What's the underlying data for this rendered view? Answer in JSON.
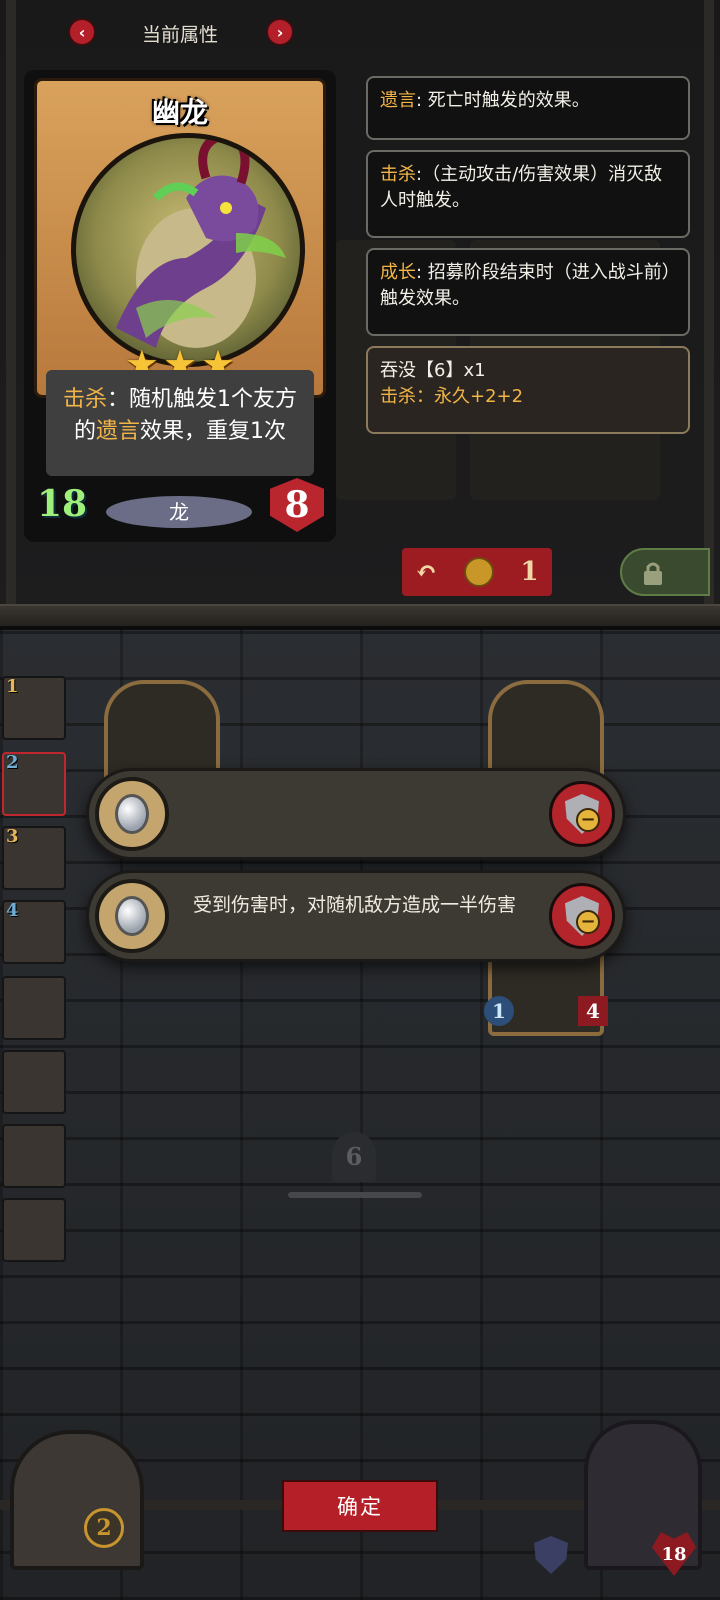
{
  "header": {
    "title": "当前属性",
    "prev_icon": "chevron-left-icon",
    "next_icon": "chevron-right-icon",
    "prev_glyph": "‹",
    "next_glyph": "›"
  },
  "card": {
    "name": "幽龙",
    "stars": 3,
    "star_glyph": "★",
    "ability_keyword": "击杀",
    "ability_part1": "：随机触发1个友方的",
    "ability_keyword2": "遗言",
    "ability_part2": "效果，重复1次",
    "attack": "18",
    "tribe": "龙",
    "health": "8"
  },
  "tooltips": [
    {
      "keyword": "遗言",
      "text": ": 死亡时触发的效果。"
    },
    {
      "keyword": "击杀",
      "text": ":（主动攻击/伤害效果）消灭敌人时触发。"
    },
    {
      "keyword": "成长",
      "text": ": 招募阶段结束时（进入战斗前）触发效果。"
    }
  ],
  "buff": {
    "line1": "吞没【6】x1",
    "line2_keyword": "击杀",
    "line2_text": "：永久+2+2"
  },
  "shop": {
    "reroll_cost": "1"
  },
  "roster": [
    {
      "num": "1",
      "color": "gold"
    },
    {
      "num": "2",
      "color": "blue"
    },
    {
      "num": "3",
      "color": "gold"
    },
    {
      "num": "4",
      "color": "blue"
    },
    {
      "num": "",
      "color": "gold"
    },
    {
      "num": "",
      "color": "gold"
    },
    {
      "num": "",
      "color": "gold"
    },
    {
      "num": "",
      "color": "gold"
    }
  ],
  "relics": [
    {
      "text": ""
    },
    {
      "text": "受到伤害时，对随机敌方造成一半伤害"
    }
  ],
  "board": {
    "turn": "6",
    "unit_attack": "1",
    "unit_health": "4"
  },
  "footer": {
    "confirm_label": "确定",
    "gate_level": "2",
    "hero_health": "18"
  },
  "colors": {
    "accent_red": "#b51f27",
    "keyword_gold": "#f3b547",
    "star_gold": "#f7c437",
    "attack_green": "#9ff07b"
  }
}
